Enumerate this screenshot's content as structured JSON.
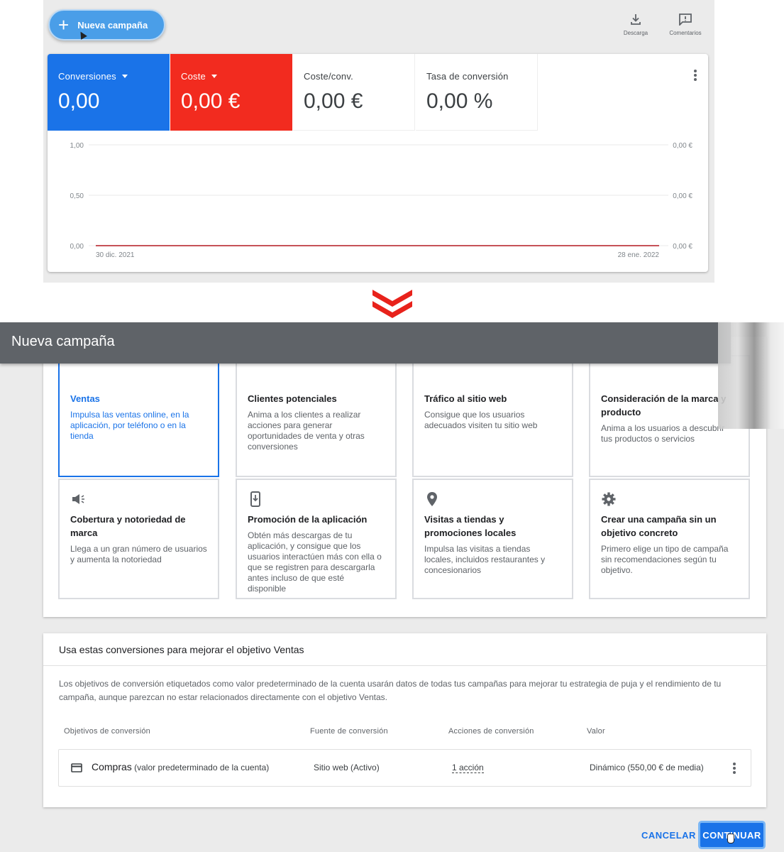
{
  "top": {
    "new_campaign_label": "Nueva campaña",
    "toolbar": {
      "download_label": "Descarga",
      "feedback_label": "Comentarios"
    },
    "metrics": [
      {
        "label": "Conversiones",
        "value": "0,00",
        "dropdown": true,
        "color": "#1a73e8"
      },
      {
        "label": "Coste",
        "value": "0,00 €",
        "dropdown": true,
        "color": "#f22b1f"
      },
      {
        "label": "Coste/conv.",
        "value": "0,00 €",
        "dropdown": false
      },
      {
        "label": "Tasa de conversión",
        "value": "0,00 %",
        "dropdown": false
      }
    ]
  },
  "chart_data": {
    "type": "line",
    "title": "",
    "x": [
      "30 dic. 2021",
      "28 ene. 2022"
    ],
    "xticks": [
      "30 dic. 2021",
      "28 ene. 2022"
    ],
    "yticks_left": [
      "1,00",
      "0,50",
      "0,00"
    ],
    "yticks_right": [
      "0,00 €",
      "0,00 €",
      "0,00 €"
    ],
    "ylim_left": [
      0,
      1
    ],
    "grid": true,
    "series": [
      {
        "name": "Conversiones",
        "color": "#1a73e8",
        "values": [
          0,
          0
        ]
      },
      {
        "name": "Coste",
        "color": "#d93025",
        "values": [
          0,
          0
        ]
      }
    ]
  },
  "dialog": {
    "title": "Nueva campaña",
    "objectives": [
      {
        "title": "Ventas",
        "desc": "Impulsa las ventas online, en la aplicación, por teléfono o en la tienda",
        "icon": "sales-icon",
        "selected": true
      },
      {
        "title": "Clientes potenciales",
        "desc": "Anima a los clientes a realizar acciones para generar oportunidades de venta y otras conversiones",
        "icon": "people-icon",
        "selected": false
      },
      {
        "title": "Tráfico al sitio web",
        "desc": "Consigue que los usuarios adecuados visiten tu sitio web",
        "icon": "cursor-click-icon",
        "selected": false
      },
      {
        "title": "Consideración de la marca y producto",
        "desc": "Anima a los usuarios a descubrir tus productos o servicios",
        "icon": "sparkle-icon",
        "selected": false
      },
      {
        "title": "Cobertura y notoriedad de marca",
        "desc": "Llega a un gran número de usuarios y aumenta la notoriedad",
        "icon": "megaphone-icon",
        "selected": false
      },
      {
        "title": "Promoción de la aplicación",
        "desc": "Obtén más descargas de tu aplicación, y consigue que los usuarios interactúen más con ella o que se registren para descargarla antes incluso de que esté disponible",
        "icon": "phone-download-icon",
        "selected": false
      },
      {
        "title": "Visitas a tiendas y promociones locales",
        "desc": "Impulsa las visitas a tiendas locales, incluidos restaurantes y concesionarios",
        "icon": "location-pin-icon",
        "selected": false
      },
      {
        "title": "Crear una campaña sin un objetivo concreto",
        "desc": "Primero elige un tipo de campaña sin recomendaciones según tu objetivo.",
        "icon": "gear-icon",
        "selected": false
      }
    ],
    "conversions": {
      "title": "Usa estas conversiones para mejorar el objetivo Ventas",
      "description": "Los objetivos de conversión etiquetados como valor predeterminado de la cuenta usarán datos de todas tus campañas para mejorar tu estrategia de puja y el rendimiento de tu campaña, aunque parezcan no estar relacionados directamente con el objetivo Ventas.",
      "columns": [
        "Objetivos de conversión",
        "Fuente de conversión",
        "Acciones de conversión",
        "Valor"
      ],
      "rows": [
        {
          "name": "Compras",
          "note": "(valor predeterminado de la cuenta)",
          "source": "Sitio web (Activo)",
          "actions": "1 acción",
          "value": "Dinámico (550,00 € de media)"
        }
      ]
    },
    "cancel_label": "CANCELAR",
    "continue_label": "CONTINUAR"
  }
}
